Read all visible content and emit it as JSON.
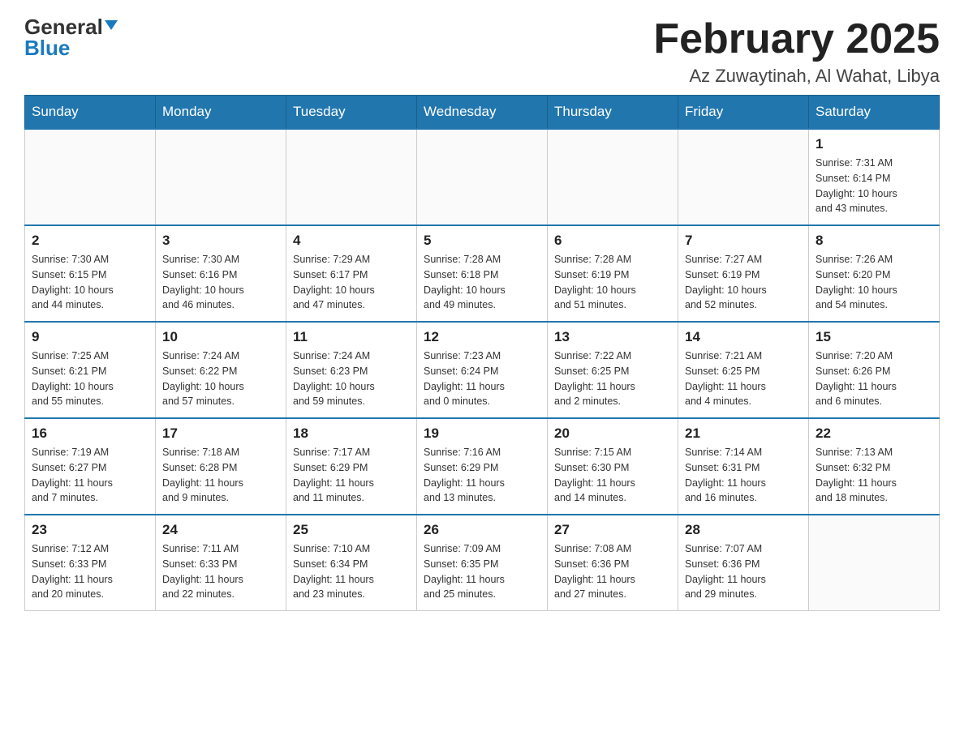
{
  "logo": {
    "general": "General",
    "blue": "Blue"
  },
  "header": {
    "title": "February 2025",
    "subtitle": "Az Zuwaytinah, Al Wahat, Libya"
  },
  "weekdays": [
    "Sunday",
    "Monday",
    "Tuesday",
    "Wednesday",
    "Thursday",
    "Friday",
    "Saturday"
  ],
  "weeks": [
    [
      {
        "day": "",
        "info": ""
      },
      {
        "day": "",
        "info": ""
      },
      {
        "day": "",
        "info": ""
      },
      {
        "day": "",
        "info": ""
      },
      {
        "day": "",
        "info": ""
      },
      {
        "day": "",
        "info": ""
      },
      {
        "day": "1",
        "info": "Sunrise: 7:31 AM\nSunset: 6:14 PM\nDaylight: 10 hours\nand 43 minutes."
      }
    ],
    [
      {
        "day": "2",
        "info": "Sunrise: 7:30 AM\nSunset: 6:15 PM\nDaylight: 10 hours\nand 44 minutes."
      },
      {
        "day": "3",
        "info": "Sunrise: 7:30 AM\nSunset: 6:16 PM\nDaylight: 10 hours\nand 46 minutes."
      },
      {
        "day": "4",
        "info": "Sunrise: 7:29 AM\nSunset: 6:17 PM\nDaylight: 10 hours\nand 47 minutes."
      },
      {
        "day": "5",
        "info": "Sunrise: 7:28 AM\nSunset: 6:18 PM\nDaylight: 10 hours\nand 49 minutes."
      },
      {
        "day": "6",
        "info": "Sunrise: 7:28 AM\nSunset: 6:19 PM\nDaylight: 10 hours\nand 51 minutes."
      },
      {
        "day": "7",
        "info": "Sunrise: 7:27 AM\nSunset: 6:19 PM\nDaylight: 10 hours\nand 52 minutes."
      },
      {
        "day": "8",
        "info": "Sunrise: 7:26 AM\nSunset: 6:20 PM\nDaylight: 10 hours\nand 54 minutes."
      }
    ],
    [
      {
        "day": "9",
        "info": "Sunrise: 7:25 AM\nSunset: 6:21 PM\nDaylight: 10 hours\nand 55 minutes."
      },
      {
        "day": "10",
        "info": "Sunrise: 7:24 AM\nSunset: 6:22 PM\nDaylight: 10 hours\nand 57 minutes."
      },
      {
        "day": "11",
        "info": "Sunrise: 7:24 AM\nSunset: 6:23 PM\nDaylight: 10 hours\nand 59 minutes."
      },
      {
        "day": "12",
        "info": "Sunrise: 7:23 AM\nSunset: 6:24 PM\nDaylight: 11 hours\nand 0 minutes."
      },
      {
        "day": "13",
        "info": "Sunrise: 7:22 AM\nSunset: 6:25 PM\nDaylight: 11 hours\nand 2 minutes."
      },
      {
        "day": "14",
        "info": "Sunrise: 7:21 AM\nSunset: 6:25 PM\nDaylight: 11 hours\nand 4 minutes."
      },
      {
        "day": "15",
        "info": "Sunrise: 7:20 AM\nSunset: 6:26 PM\nDaylight: 11 hours\nand 6 minutes."
      }
    ],
    [
      {
        "day": "16",
        "info": "Sunrise: 7:19 AM\nSunset: 6:27 PM\nDaylight: 11 hours\nand 7 minutes."
      },
      {
        "day": "17",
        "info": "Sunrise: 7:18 AM\nSunset: 6:28 PM\nDaylight: 11 hours\nand 9 minutes."
      },
      {
        "day": "18",
        "info": "Sunrise: 7:17 AM\nSunset: 6:29 PM\nDaylight: 11 hours\nand 11 minutes."
      },
      {
        "day": "19",
        "info": "Sunrise: 7:16 AM\nSunset: 6:29 PM\nDaylight: 11 hours\nand 13 minutes."
      },
      {
        "day": "20",
        "info": "Sunrise: 7:15 AM\nSunset: 6:30 PM\nDaylight: 11 hours\nand 14 minutes."
      },
      {
        "day": "21",
        "info": "Sunrise: 7:14 AM\nSunset: 6:31 PM\nDaylight: 11 hours\nand 16 minutes."
      },
      {
        "day": "22",
        "info": "Sunrise: 7:13 AM\nSunset: 6:32 PM\nDaylight: 11 hours\nand 18 minutes."
      }
    ],
    [
      {
        "day": "23",
        "info": "Sunrise: 7:12 AM\nSunset: 6:33 PM\nDaylight: 11 hours\nand 20 minutes."
      },
      {
        "day": "24",
        "info": "Sunrise: 7:11 AM\nSunset: 6:33 PM\nDaylight: 11 hours\nand 22 minutes."
      },
      {
        "day": "25",
        "info": "Sunrise: 7:10 AM\nSunset: 6:34 PM\nDaylight: 11 hours\nand 23 minutes."
      },
      {
        "day": "26",
        "info": "Sunrise: 7:09 AM\nSunset: 6:35 PM\nDaylight: 11 hours\nand 25 minutes."
      },
      {
        "day": "27",
        "info": "Sunrise: 7:08 AM\nSunset: 6:36 PM\nDaylight: 11 hours\nand 27 minutes."
      },
      {
        "day": "28",
        "info": "Sunrise: 7:07 AM\nSunset: 6:36 PM\nDaylight: 11 hours\nand 29 minutes."
      },
      {
        "day": "",
        "info": ""
      }
    ]
  ]
}
